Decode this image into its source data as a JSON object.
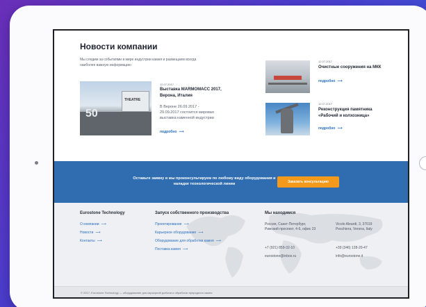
{
  "news": {
    "title": "Новости компании",
    "intro": "Мы следим за событиями в мире индустрии камня и размещаем всегда наиболее важную информацию",
    "featured": {
      "date": "12.07.2017",
      "title": "Выставка MARMOMACC 2017, Верона, Италия",
      "text": "В Вероне 26.09.2017 - 29.09.2017 состоится мировая выставка каменной индустрии",
      "more": "подробно"
    },
    "side": [
      {
        "date": "12.07.2017",
        "title": "Очистные сооружения на МКК",
        "more": "подробно"
      },
      {
        "date": "12.07.2017",
        "title": "Реконструкция памятника «Рабочий и колхозница»",
        "more": "подробно"
      }
    ]
  },
  "cta": {
    "text": "Оставьте заявку и мы проконсультируем по любому виду оборудования и наладке технологической линии",
    "button": "Заказать консультацию"
  },
  "footer": {
    "col1": {
      "title": "Eurostone Technology",
      "links": [
        "О компании",
        "Новости",
        "Контакты"
      ]
    },
    "col2": {
      "title": "Запуск собственного производства",
      "links": [
        "Проектирование",
        "Карьерное оборудование",
        "Оборудование для обработки камня",
        "Поставка камня"
      ]
    },
    "col3": {
      "title": "Мы находимся",
      "ru_address": "Россия, Санкт-Петербург, Рижский проспект, 4-6, офис 23",
      "ru_phone": "+7 (921) 859-32-10",
      "ru_email": "eurostone@inbox.ru",
      "it_address": "Vicolo Aleardi, 3, 37019 Peschiera, Verona, Italy",
      "it_phone": "+39 (346) 128-20-47",
      "it_email": "info@eurostone.it"
    },
    "copyright": "© 2017, Eurostone Technology — оборудование для карьерной добычи и обработки природного камня"
  },
  "colors": {
    "accent": "#2f6cb0",
    "cta_button": "#f39a1c",
    "link": "#2a6fc0"
  }
}
